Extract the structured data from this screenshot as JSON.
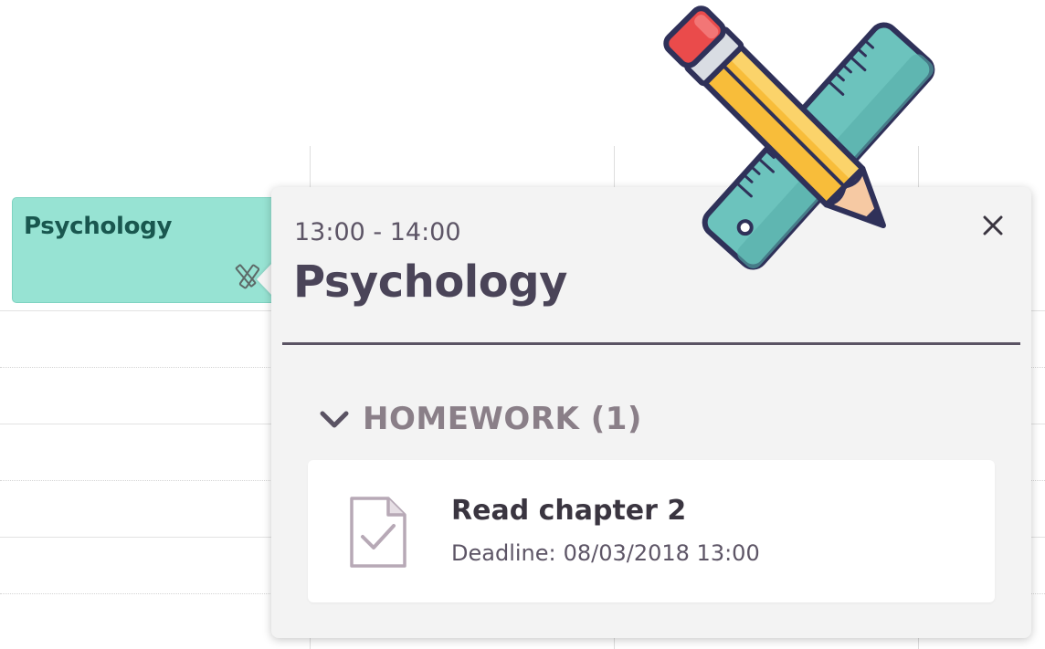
{
  "event": {
    "title": "Psychology"
  },
  "popover": {
    "time": "13:00 - 14:00",
    "title": "Psychology",
    "close_icon": "close-icon",
    "section": {
      "label": "HOMEWORK (1)",
      "expanded": true,
      "chevron_icon": "chevron-down-icon"
    },
    "homework": [
      {
        "title": "Read chapter 2",
        "deadline_label": "Deadline:",
        "deadline_value": "08/03/2018 13:00",
        "icon": "document-check-icon"
      }
    ]
  },
  "illustration": {
    "icon": "pencil-ruler-icon"
  },
  "colors": {
    "event_bg": "#97e3d3",
    "event_text": "#19574f",
    "popover_bg": "#f3f3f3",
    "title_text": "#4a4458",
    "section_text": "#8a7f88",
    "ruler": "#6cc3bd",
    "pencil": "#f8bd3a",
    "eraser": "#ea4b4b"
  }
}
